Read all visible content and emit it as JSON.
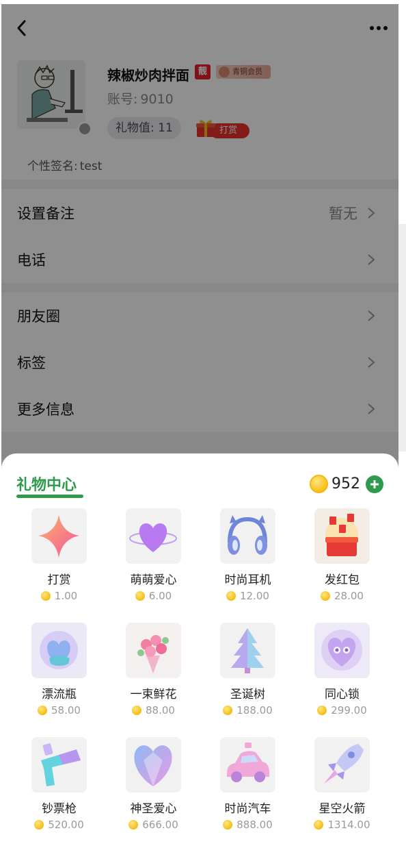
{
  "profile": {
    "nickname": "辣椒炒肉拌面",
    "liang_badge": "靓",
    "member_badge": "青铜会员",
    "account_label": "账号:",
    "account_value": "9010",
    "gift_value_label": "礼物值:",
    "gift_value": "11",
    "tip_label": "打赏",
    "signature_label": "个性签名:",
    "signature_value": "test"
  },
  "rows": {
    "remark_label": "设置备注",
    "remark_value": "暂无",
    "phone_label": "电话",
    "moments_label": "朋友圈",
    "tags_label": "标签",
    "more_info_label": "更多信息"
  },
  "gift_center": {
    "title": "礼物中心",
    "balance": "952",
    "gifts": [
      {
        "name": "打赏",
        "price": "1.00"
      },
      {
        "name": "萌萌爱心",
        "price": "6.00"
      },
      {
        "name": "时尚耳机",
        "price": "12.00"
      },
      {
        "name": "发红包",
        "price": "28.00"
      },
      {
        "name": "漂流瓶",
        "price": "58.00"
      },
      {
        "name": "一束鲜花",
        "price": "88.00"
      },
      {
        "name": "圣诞树",
        "price": "188.00"
      },
      {
        "name": "同心锁",
        "price": "299.00"
      },
      {
        "name": "钞票枪",
        "price": "520.00"
      },
      {
        "name": "神圣爱心",
        "price": "666.00"
      },
      {
        "name": "时尚汽车",
        "price": "888.00"
      },
      {
        "name": "星空火箭",
        "price": "1314.00"
      }
    ]
  },
  "colors": {
    "accent_green": "#2e9a4c",
    "tip_red": "#e8332d",
    "coin_gold": "#f7c11e",
    "overlay": "rgba(0,0,0,0.44)"
  }
}
